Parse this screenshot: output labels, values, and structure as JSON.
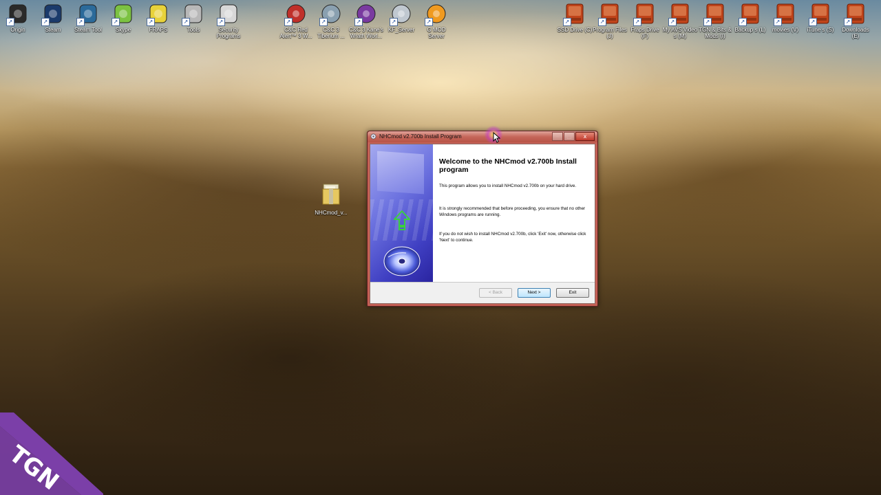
{
  "desktop": {
    "left_icons": [
      {
        "label": "Origin",
        "icon": "origin-icon",
        "color": "#2a2a2a"
      },
      {
        "label": "Steam",
        "icon": "steam-icon",
        "color": "#1b3a6b"
      },
      {
        "label": "Steam Tool",
        "icon": "steam-tool-icon",
        "color": "#2b6a9a"
      },
      {
        "label": "Skype",
        "icon": "skype-icon",
        "color": "#7cc242"
      },
      {
        "label": "FRAPS",
        "icon": "fraps-icon",
        "color": "#e8d23a"
      },
      {
        "label": "Tools",
        "icon": "tools-icon",
        "color": "#b8b8b8"
      },
      {
        "label": "Security Programs",
        "icon": "lock-icon",
        "color": "#d8d8d8"
      }
    ],
    "game_icons": [
      {
        "label": "C&C Red Alert™ 3 W...",
        "icon": "red-alert-icon",
        "color": "#c0302a"
      },
      {
        "label": "C&C 3 Tiberium ...",
        "icon": "tiberium-icon",
        "color": "#8aa0b0"
      },
      {
        "label": "C&C 3 Kane's Wrath Worl...",
        "icon": "kanes-wrath-icon",
        "color": "#7a3aa0"
      },
      {
        "label": "KF_Server",
        "icon": "server-icon",
        "color": "#c0c8d0"
      },
      {
        "label": "G MOD Server",
        "icon": "half-life-icon",
        "color": "#f09a20"
      }
    ],
    "drive_icons": [
      {
        "label": "SSD Drive (C)",
        "icon": "drive-icon"
      },
      {
        "label": "Program Files (J)",
        "icon": "drive-icon"
      },
      {
        "label": "Fraps Drive (F)",
        "icon": "drive-icon"
      },
      {
        "label": "My AVS Video s (M)",
        "icon": "drive-icon"
      },
      {
        "label": "TGN & Bits & Mods (I)",
        "icon": "drive-icon"
      },
      {
        "label": "Backup s (L)",
        "icon": "drive-icon"
      },
      {
        "label": "movies (V)",
        "icon": "drive-icon"
      },
      {
        "label": "iTune s (S)",
        "icon": "drive-icon"
      },
      {
        "label": "Downloads (E)",
        "icon": "drive-icon"
      }
    ],
    "drive_color": "#c0441a",
    "folder": {
      "label": "NHCmod_v..."
    }
  },
  "dialog": {
    "title": "NHCmod v2.700b Install Program",
    "heading": "Welcome to the NHCmod v2.700b Install program",
    "paragraph1": "This program allows you to install NHCmod v2.700b on your hard drive.",
    "paragraph2": "It is strongly recommended that before proceeding, you ensure that no other Windows programs are running.",
    "paragraph3": "If you do not wish to install NHCmod v2.700b, click 'Exit' now, otherwise click 'Next' to continue.",
    "back_label": "< Back",
    "next_label": "Next >",
    "exit_label": "Exit",
    "minimize_label": "–",
    "maximize_label": "□",
    "close_label": "x"
  },
  "watermark": {
    "text": "TGN",
    "color": "#7b3fa8"
  }
}
